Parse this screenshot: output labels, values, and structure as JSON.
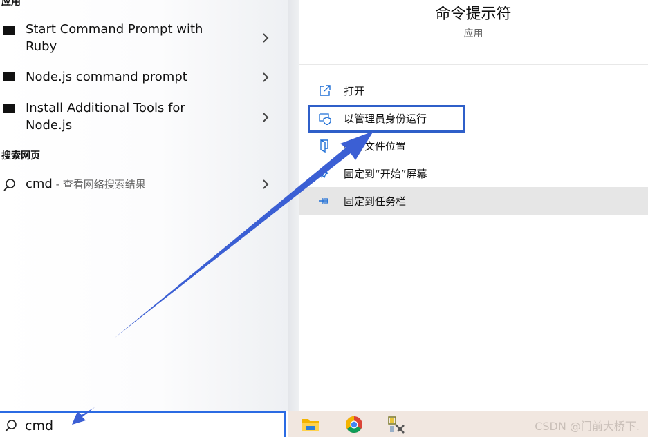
{
  "results": {
    "apps_heading": "应用",
    "items": [
      {
        "label_line1": "Start Command Prompt with",
        "label_line2": "Ruby"
      },
      {
        "label_line1": "Node.js command prompt",
        "label_line2": ""
      },
      {
        "label_line1": "Install Additional Tools for",
        "label_line2": "Node.js"
      }
    ],
    "web_heading": "搜索网页",
    "web_item": {
      "query": "cmd",
      "suffix": " - 查看网络搜索结果"
    }
  },
  "search": {
    "value": "cmd"
  },
  "detail": {
    "title": "命令提示符",
    "subtitle": "应用",
    "actions": [
      {
        "label": "打开",
        "icon": "open-icon"
      },
      {
        "label": "以管理员身份运行",
        "icon": "shield-icon"
      },
      {
        "label": "打开文件位置",
        "icon": "file-location-icon"
      },
      {
        "label": "固定到“开始”屏幕",
        "icon": "pin-start-icon"
      },
      {
        "label": "固定到任务栏",
        "icon": "pin-taskbar-icon"
      }
    ]
  },
  "taskbar": {
    "icons": [
      "file-explorer-icon",
      "chrome-icon",
      "tools-icon"
    ],
    "watermark": "CSDN @门前大桥下."
  },
  "colors": {
    "accent": "#2b6be3",
    "annotation": "#2f5fc9",
    "icon_blue": "#1f6fd6"
  }
}
